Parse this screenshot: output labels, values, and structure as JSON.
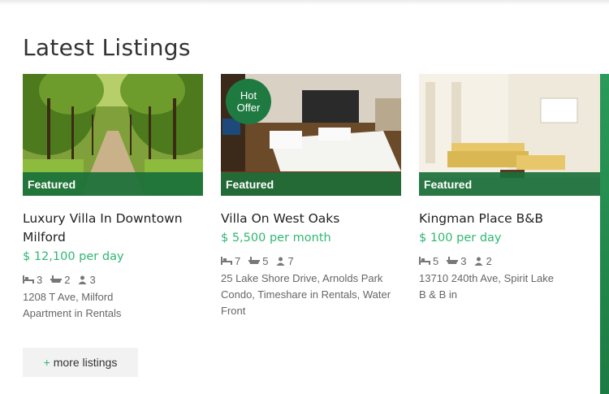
{
  "section": {
    "title": "Latest Listings"
  },
  "listings": [
    {
      "title": "Luxury Villa In Downtown Milford",
      "price": "$ 12,100 per day",
      "badge": "Featured",
      "beds": "3",
      "baths": "2",
      "guests": "3",
      "address": "1208 T Ave, Milford",
      "meta": "Apartment in Rentals",
      "image": "tree-lined-path"
    },
    {
      "title": "Villa On West Oaks",
      "price": "$ 5,500 per month",
      "badge": "Featured",
      "hot_label_1": "Hot",
      "hot_label_2": "Offer",
      "beds": "7",
      "baths": "5",
      "guests": "7",
      "address": "25 Lake Shore Drive, Arnolds Park",
      "meta": "Condo, Timeshare in Rentals, Water Front",
      "image": "hotel-bedroom"
    },
    {
      "title": "Kingman Place B&B",
      "price": "$ 100 per day",
      "badge": "Featured",
      "beds": "5",
      "baths": "3",
      "guests": "2",
      "address": "13710 240th Ave, Spirit Lake",
      "meta": "B & B in",
      "image": "living-room"
    }
  ],
  "more_button": {
    "plus": "+",
    "label": "more listings"
  },
  "colors": {
    "accent": "#2eb872",
    "badge_green": "#1a703a"
  }
}
